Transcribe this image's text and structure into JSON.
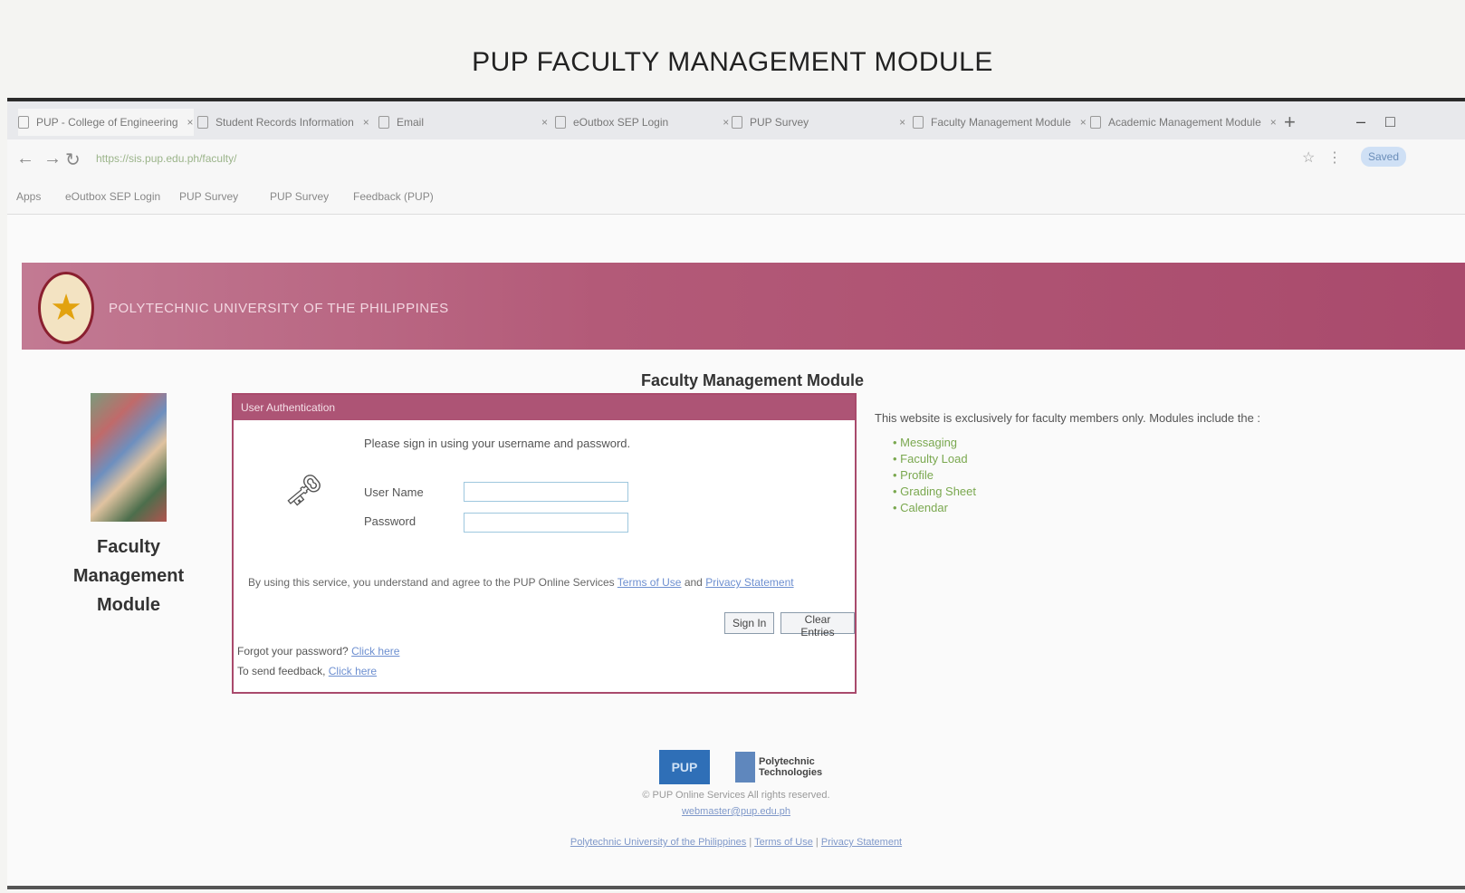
{
  "document_title": "PUP FACULTY MANAGEMENT MODULE",
  "browser": {
    "tabs": [
      {
        "label": "PUP - College of Engineering"
      },
      {
        "label": "Student Records Information"
      },
      {
        "label": "Email"
      },
      {
        "label": "eOutbox SEP Login"
      },
      {
        "label": "PUP Survey"
      },
      {
        "label": "Faculty Management Module"
      },
      {
        "label": "Academic Management Module"
      }
    ],
    "url": "https://sis.pup.edu.ph/faculty/",
    "bookmarks": [
      "Apps",
      "eOutbox SEP Login",
      "PUP Survey",
      "PUP Survey",
      "Feedback (PUP)"
    ],
    "profile_label": "Saved"
  },
  "banner": {
    "text": "POLYTECHNIC UNIVERSITY OF THE PHILIPPINES"
  },
  "page_heading": "Faculty Management Module",
  "sidebar": {
    "caption_line1": "Faculty",
    "caption_line2": "Management",
    "caption_line3": "Module"
  },
  "login": {
    "header": "User Authentication",
    "instruction": "Please sign in using your username and password.",
    "username_label": "User Name",
    "password_label": "Password",
    "username_value": "",
    "password_value": "",
    "terms_prefix": "By using this service, you understand and agree to the PUP Online Services",
    "terms_link": "Terms of Use",
    "terms_and": "and",
    "privacy_link": "Privacy Statement",
    "sign_in_button": "Sign In",
    "clear_button": "Clear Entries",
    "forgot_text": "Forgot your password?",
    "forgot_link": "Click here",
    "feedback_text": "To send feedback,",
    "feedback_link": "Click here"
  },
  "info": {
    "intro": "This website is exclusively for faculty members only. Modules include the :",
    "items": [
      "Messaging",
      "Faculty Load",
      "Profile",
      "Grading Sheet",
      "Calendar"
    ]
  },
  "footer": {
    "logo_a": "PUP",
    "logo_b_line1": "Polytechnic",
    "logo_b_line2": "Technologies",
    "copyright": "© PUP Online Services All rights reserved.",
    "contact": "webmaster@pup.edu.ph",
    "link1": "Polytechnic University of the Philippines",
    "link2": "Terms of Use",
    "link3": "Privacy Statement"
  }
}
